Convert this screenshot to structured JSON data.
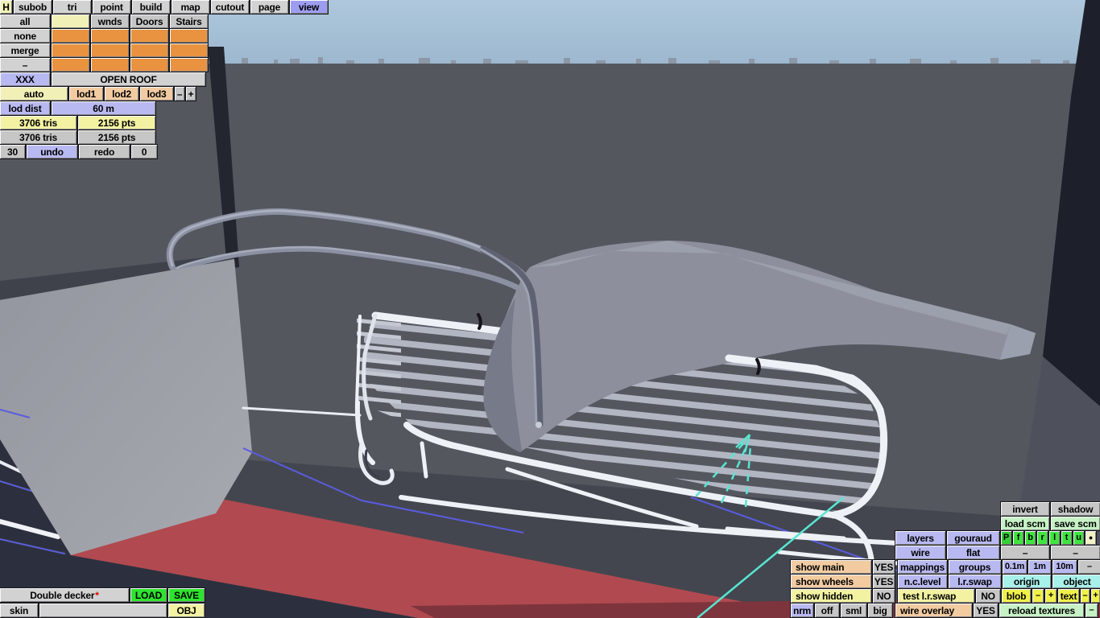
{
  "menu": {
    "tabs": [
      "H",
      "subob",
      "tri",
      "point",
      "build",
      "map",
      "cutout",
      "page",
      "view"
    ]
  },
  "subobjects": {
    "row_labels": [
      "all",
      "none",
      "merge",
      "–"
    ],
    "col_buttons": [
      "wnds",
      "Doors",
      "Stairs"
    ],
    "xxx": "XXX",
    "open_roof": "OPEN ROOF"
  },
  "lod": {
    "auto": "auto",
    "lods": [
      "lod1",
      "lod2",
      "lod3"
    ],
    "minus": "–",
    "plus": "+",
    "dist_label": "lod dist",
    "dist_value": "60 m"
  },
  "stats": {
    "tris_current": "3706 tris",
    "pts_current": "2156 pts",
    "tris_lod": "3706 tris",
    "pts_lod": "2156 pts",
    "undo_count": "30",
    "undo": "undo",
    "redo": "redo",
    "redo_count": "0"
  },
  "file": {
    "model_name": "Double decker",
    "modified_marker": "*",
    "load": "LOAD",
    "save": "SAVE",
    "skin": "skin",
    "obj": "OBJ"
  },
  "right": {
    "invert": "invert",
    "shadow": "shadow",
    "load_scm": "load scm",
    "save_scm": "save scm",
    "proj": [
      "P",
      "f",
      "b",
      "r",
      "l",
      "t",
      "u"
    ],
    "dot": "●",
    "layers": "layers",
    "gouraud": "gouraud",
    "wire": "wire",
    "flat": "flat",
    "dash": "–",
    "show_main": "show main",
    "show_main_val": "YES",
    "mappings": "mappings",
    "groups": "groups",
    "snap": [
      "0.1m",
      "1m",
      "10m",
      "–"
    ],
    "show_wheels": "show wheels",
    "show_wheels_val": "YES",
    "nc_level": "n.c.level",
    "lr_swap": "l.r.swap",
    "origin": "origin",
    "object": "object",
    "show_hidden": "show hidden",
    "show_hidden_val": "NO",
    "test_lr_swap": "test l.r.swap",
    "test_lr_swap_val": "NO",
    "blob": "blob",
    "minus": "–",
    "plus": "+",
    "text": "text",
    "nrm": "nrm",
    "off": "off",
    "sml": "sml",
    "big": "big",
    "wire_overlay": "wire overlay",
    "wire_overlay_val": "YES",
    "reload_textures": "reload textures"
  },
  "scene_colors": {
    "sky_top": "#aec7dc",
    "sky_bottom": "#9db8cf",
    "wall": "#55575f",
    "floor": "#43464f",
    "pillar": "#1d202a",
    "panel": "#9da0a8",
    "carpet_red": "#b04a50",
    "carpet_dark": "#7e343c",
    "navy_floor": "#2c303e",
    "rack_white": "#eef1f6",
    "slat_gray": "#b2b6c2",
    "roof_gray": "#8d909c",
    "grid_blue": "#5a5ce0",
    "gizmo_cyan": "#57e6d2"
  }
}
